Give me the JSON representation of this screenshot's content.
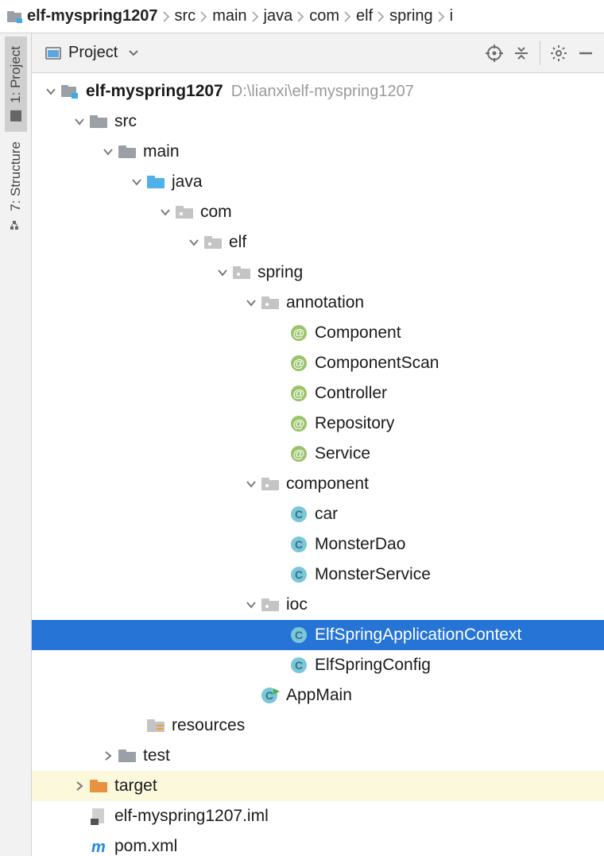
{
  "breadcrumb": {
    "items": [
      "elf-myspring1207",
      "src",
      "main",
      "java",
      "com",
      "elf",
      "spring",
      "i"
    ]
  },
  "sideTabs": {
    "project": "1: Project",
    "structure": "7: Structure"
  },
  "panel": {
    "title": "Project"
  },
  "tree": {
    "root": {
      "name": "elf-myspring1207",
      "path": "D:\\lianxi\\elf-myspring1207"
    },
    "nodes": [
      {
        "id": 0,
        "depth": 0,
        "exp": "down",
        "icon": "module",
        "label": "elf-myspring1207",
        "bold": true,
        "sublabel": "D:\\lianxi\\elf-myspring1207"
      },
      {
        "id": 1,
        "depth": 1,
        "exp": "down",
        "icon": "folder-gray",
        "label": "src"
      },
      {
        "id": 2,
        "depth": 2,
        "exp": "down",
        "icon": "folder-gray",
        "label": "main"
      },
      {
        "id": 3,
        "depth": 3,
        "exp": "down",
        "icon": "folder-blue",
        "label": "java"
      },
      {
        "id": 4,
        "depth": 4,
        "exp": "down",
        "icon": "pkg",
        "label": "com"
      },
      {
        "id": 5,
        "depth": 5,
        "exp": "down",
        "icon": "pkg",
        "label": "elf"
      },
      {
        "id": 6,
        "depth": 6,
        "exp": "down",
        "icon": "pkg",
        "label": "spring"
      },
      {
        "id": 7,
        "depth": 7,
        "exp": "down",
        "icon": "pkg",
        "label": "annotation"
      },
      {
        "id": 8,
        "depth": 8,
        "exp": "none",
        "icon": "anno",
        "label": "Component"
      },
      {
        "id": 9,
        "depth": 8,
        "exp": "none",
        "icon": "anno",
        "label": "ComponentScan"
      },
      {
        "id": 10,
        "depth": 8,
        "exp": "none",
        "icon": "anno",
        "label": "Controller"
      },
      {
        "id": 11,
        "depth": 8,
        "exp": "none",
        "icon": "anno",
        "label": "Repository"
      },
      {
        "id": 12,
        "depth": 8,
        "exp": "none",
        "icon": "anno",
        "label": "Service"
      },
      {
        "id": 13,
        "depth": 7,
        "exp": "down",
        "icon": "pkg",
        "label": "component"
      },
      {
        "id": 14,
        "depth": 8,
        "exp": "none",
        "icon": "class",
        "label": "car"
      },
      {
        "id": 15,
        "depth": 8,
        "exp": "none",
        "icon": "class",
        "label": "MonsterDao"
      },
      {
        "id": 16,
        "depth": 8,
        "exp": "none",
        "icon": "class",
        "label": "MonsterService"
      },
      {
        "id": 17,
        "depth": 7,
        "exp": "down",
        "icon": "pkg",
        "label": "ioc"
      },
      {
        "id": 18,
        "depth": 8,
        "exp": "none",
        "icon": "class",
        "label": "ElfSpringApplicationContext",
        "selected": true
      },
      {
        "id": 19,
        "depth": 8,
        "exp": "none",
        "icon": "class",
        "label": "ElfSpringConfig"
      },
      {
        "id": 20,
        "depth": 7,
        "exp": "none",
        "icon": "class-run",
        "label": "AppMain"
      },
      {
        "id": 21,
        "depth": 3,
        "exp": "none",
        "icon": "resources",
        "label": "resources"
      },
      {
        "id": 22,
        "depth": 2,
        "exp": "right",
        "icon": "folder-gray",
        "label": "test"
      },
      {
        "id": 23,
        "depth": 1,
        "exp": "right",
        "icon": "folder-orange",
        "label": "target",
        "hl": true
      },
      {
        "id": 24,
        "depth": 1,
        "exp": "none",
        "icon": "iml",
        "label": "elf-myspring1207.iml"
      },
      {
        "id": 25,
        "depth": 1,
        "exp": "none",
        "icon": "pom",
        "label": "pom.xml"
      }
    ]
  }
}
